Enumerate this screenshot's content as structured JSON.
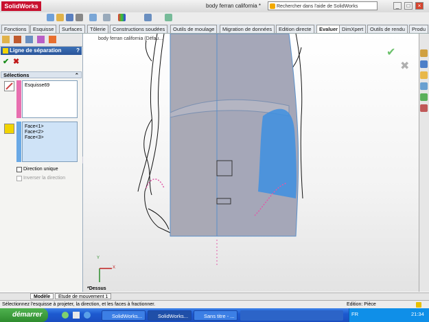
{
  "app": {
    "logo": "SolidWorks",
    "document_title": "body ferran california *"
  },
  "help_search": {
    "placeholder": "Rechercher dans l'aide de SolidWorks"
  },
  "window_controls": {
    "minimize": "_",
    "restore": "□",
    "close": "×"
  },
  "command_tabs": [
    "Fonctions",
    "Esquisse",
    "Surfaces",
    "Tôlerie",
    "Constructions soudées",
    "Outils de moulage",
    "Migration de données",
    "Edition directe",
    "Evaluer",
    "DimXpert",
    "Outils de rendu",
    "Produ"
  ],
  "active_command_tab": "Evaluer",
  "tree_breadcrumb": "body ferran california (Défau...",
  "property_manager": {
    "title": "Ligne de séparation",
    "help": "?",
    "ok": "✔",
    "cancel": "✖",
    "selections_header": "Sélections",
    "sketch_items": [
      "Esquisse69"
    ],
    "face_items": [
      "Face<1>",
      "Face<2>",
      "Face<3>"
    ],
    "direction_unique_label": "Direction unique",
    "inverser_label": "Inverser la direction"
  },
  "view": {
    "orientation_label": "*Dessus",
    "axis_x": "X",
    "axis_y": "Y"
  },
  "bottom_tabs": [
    "Modèle",
    "Etude de mouvement 1"
  ],
  "status": {
    "message": "Sélectionnez l'esquisse à projeter, la direction, et les faces à fractionner.",
    "mode": "Edition: Pièce"
  },
  "taskbar": {
    "start": "démarrer",
    "tasks": [
      "SolidWorks...",
      "SolidWorks...",
      "Sans titre - ..."
    ],
    "language": "FR",
    "clock": "21:34"
  },
  "colors": {
    "accent_blue": "#2a5599",
    "surface_gray": "#a9a9b5",
    "selected_face": "#3d8fe0",
    "split_line": "#e05aa8"
  }
}
